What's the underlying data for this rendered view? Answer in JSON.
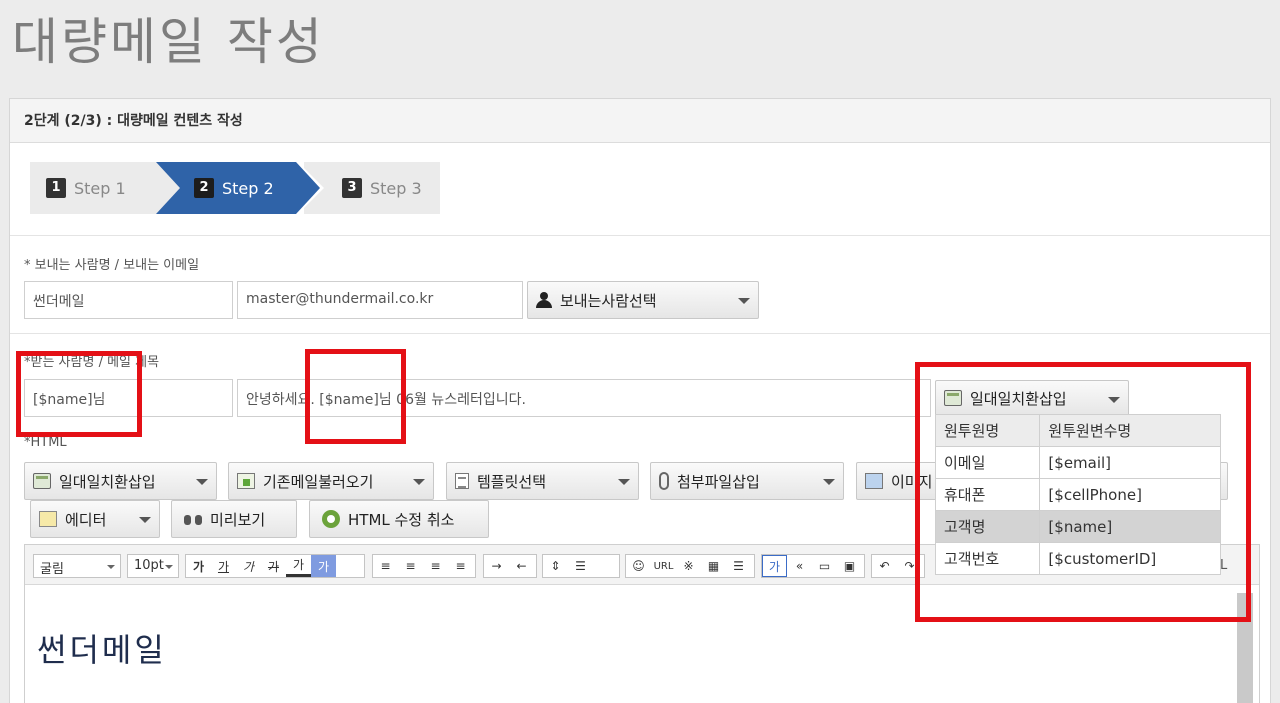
{
  "page": {
    "title": "대량메일 작성"
  },
  "panel": {
    "header": "2단계 (2/3) : 대량메일 컨텐츠 작성"
  },
  "steps": [
    {
      "num": "1",
      "label": "Step 1"
    },
    {
      "num": "2",
      "label": "Step 2"
    },
    {
      "num": "3",
      "label": "Step 3"
    }
  ],
  "sender": {
    "label": "* 보내는 사람명 / 보내는 이메일",
    "name": "썬더메일",
    "email": "master@thundermail.co.kr",
    "select_label": "보내는사람선택"
  },
  "recipient": {
    "label": "*받는 사람명 / 메일 제목",
    "name": "[$name]님",
    "subject": "안녕하세요. [$name]님 06월 뉴스레터입니다.",
    "insert_label": "일대일치환삽입"
  },
  "html_section": {
    "label": "*HTML",
    "buttons": {
      "insert": "일대일치환삽입",
      "load": "기존메일불러오기",
      "template": "템플릿선택",
      "attach": "첨부파일삽입",
      "image": "이미지",
      "editor": "에디터",
      "preview": "미리보기",
      "cancel_html": "HTML 수정 취소"
    }
  },
  "toolbar": {
    "font": "굴림",
    "size": "10pt",
    "format_buttons": [
      "가",
      "가",
      "가",
      "가",
      "가",
      "가"
    ],
    "align_buttons": [
      "≡",
      "≡",
      "≡",
      "≡"
    ],
    "indent_buttons": [
      "→",
      "←"
    ],
    "misc_buttons": [
      "☺",
      "URL",
      "※",
      "▦",
      "☰"
    ],
    "extra_buttons": [
      "가",
      "«",
      "▭",
      "▣"
    ],
    "undo_buttons": [
      "↶",
      "↷"
    ],
    "tail": "L"
  },
  "editor": {
    "content": "썬더메일"
  },
  "dropdown": {
    "headers": [
      "원투원명",
      "원투원변수명"
    ],
    "rows": [
      {
        "name": "이메일",
        "var": "[$email]"
      },
      {
        "name": "휴대폰",
        "var": "[$cellPhone]"
      },
      {
        "name": "고객명",
        "var": "[$name]"
      },
      {
        "name": "고객번호",
        "var": "[$customerID]"
      }
    ]
  },
  "colors": {
    "accent": "#2f63a8",
    "annotation": "#e41016"
  }
}
